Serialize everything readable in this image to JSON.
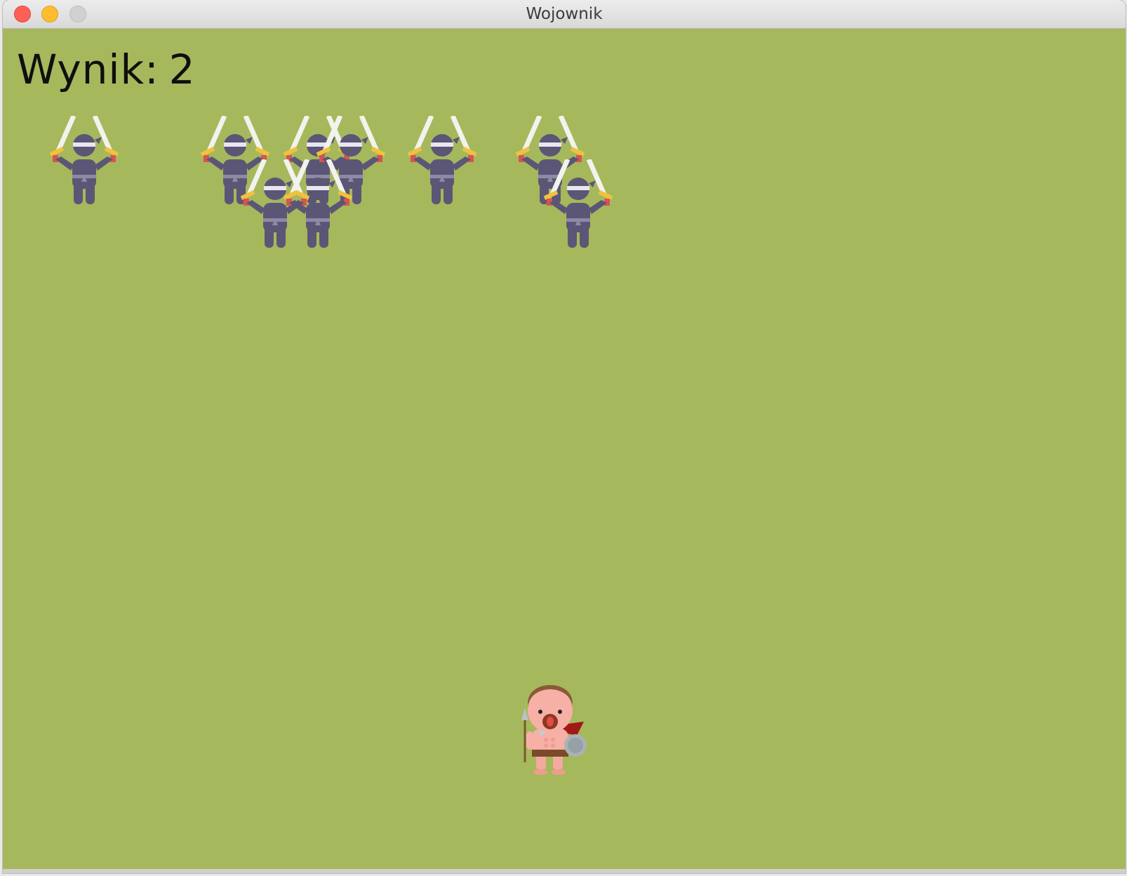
{
  "window": {
    "title": "Wojownik"
  },
  "hud": {
    "score_label": "Wynik:",
    "score_value": "2"
  },
  "colors": {
    "field": "#a6b85c",
    "ninja_body": "#5b5676",
    "sword_blade": "#f2f2ee",
    "sword_hilt": "#f0c23e",
    "headband": "#e9e6f0"
  },
  "sprites": {
    "enemy": "ninja-icon",
    "player": "warrior-icon"
  },
  "enemies_visible": 9
}
